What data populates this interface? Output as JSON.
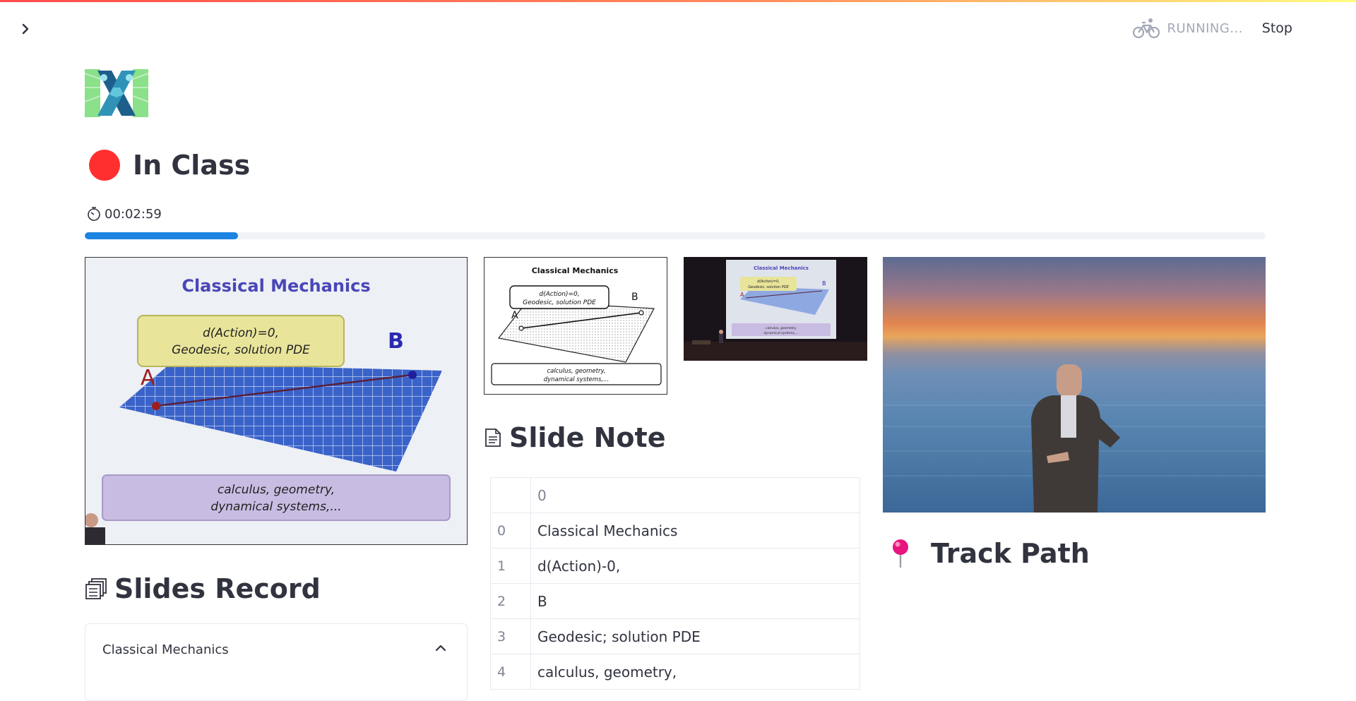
{
  "header": {
    "status_text": "RUNNING...",
    "stop_label": "Stop",
    "status_icon": "bicycle-icon",
    "sidebar_toggle_icon": "chevron-right-icon"
  },
  "app": {
    "title": "In Class",
    "status_color": "#ff2f2f",
    "timer": "00:02:59",
    "progress": 0.13,
    "accent": "#1c83e1"
  },
  "main_slide": {
    "title": "Classical Mechanics",
    "box_text_1": "d(Action)=0,",
    "box_text_2": "Geodesic, solution PDE",
    "point_a": "A",
    "point_b": "B",
    "footer_1": "calculus, geometry,",
    "footer_2": "dynamical systems,..."
  },
  "sketch_slide": {
    "title": "Classical Mechanics",
    "box_text_1": "d(Action)=0,",
    "box_text_2": "Geodesic, solution PDE",
    "point_a": "A",
    "point_b": "B",
    "footer_1": "calculus, geometry,",
    "footer_2": "dynamical systems,..."
  },
  "stage_slide": {
    "title": "Classical Mechanics",
    "box_text_1": "d(Action)=0,",
    "box_text_2": "Geodesic, solution PDE",
    "point_a": "A",
    "point_b": "B",
    "footer_1": "calculus, geometry,",
    "footer_2": "dynamical systems,..."
  },
  "slides_record": {
    "heading": "Slides Record",
    "icon": "card-index-icon",
    "expander_label": "Classical Mechanics"
  },
  "slide_note": {
    "heading": "Slide Note",
    "icon": "memo-icon",
    "column_header": "0",
    "rows": [
      {
        "index": "0",
        "text": "Classical Mechanics"
      },
      {
        "index": "1",
        "text": "d(Action)-0,"
      },
      {
        "index": "2",
        "text": "B"
      },
      {
        "index": "3",
        "text": "Geodesic; solution PDE"
      },
      {
        "index": "4",
        "text": "calculus, geometry,"
      }
    ]
  },
  "track_path": {
    "heading": "Track Path",
    "icon": "round-pushpin-icon"
  }
}
